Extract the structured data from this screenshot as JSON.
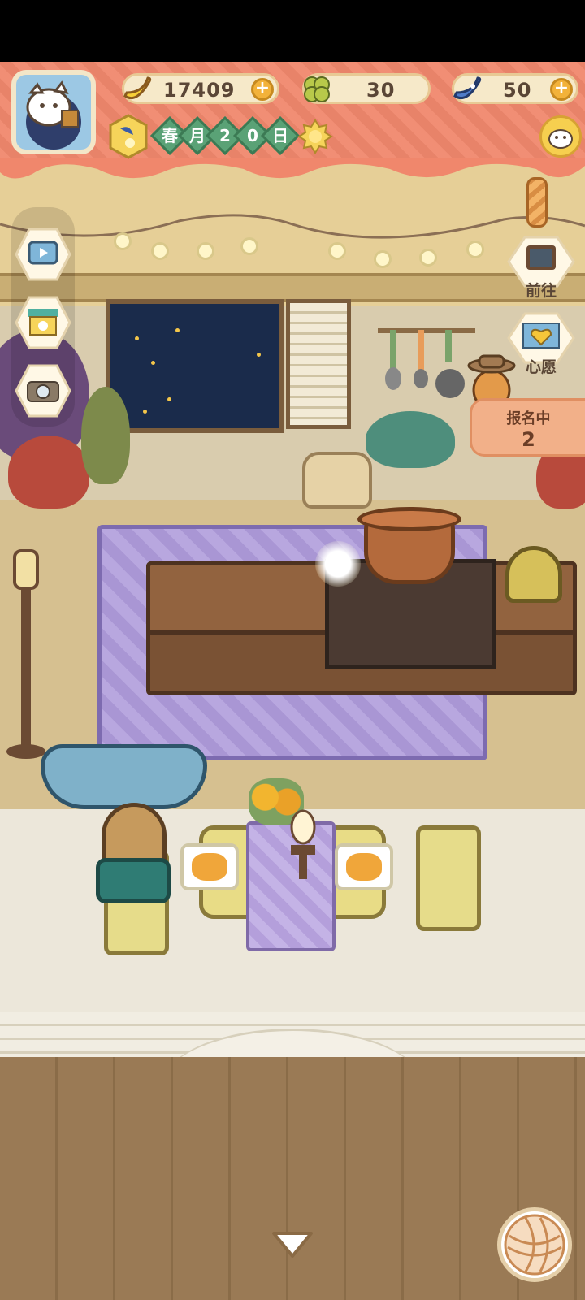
{
  "resources": {
    "bananas": {
      "icon": "banana-icon",
      "value": "17409",
      "plus": "+"
    },
    "clovers": {
      "icon": "clover-icon",
      "value": "30",
      "plus": ""
    },
    "blue_bananas": {
      "icon": "blue-banana-icon",
      "value": "50",
      "plus": "+"
    }
  },
  "date": {
    "chars": [
      "春",
      "月",
      "2",
      "0",
      "日"
    ],
    "season_icon": "moon-star-badge-icon",
    "weather_icon": "sun-icon"
  },
  "side_nav": {
    "go": {
      "label": "前往",
      "icon": "notice-board-icon"
    },
    "wish": {
      "label": "心愿",
      "icon": "heart-book-icon"
    }
  },
  "signup": {
    "title": "报名中",
    "count": "2"
  },
  "left_tools": [
    "tv-icon",
    "shop-stall-icon",
    "camera-icon"
  ],
  "colors": {
    "hud_band": "#f0876c",
    "resource_pill": "#f6e9c9",
    "plus_button": "#f2b23a",
    "date_chip": "#5aa276",
    "signup_pill": "#f2b089"
  }
}
